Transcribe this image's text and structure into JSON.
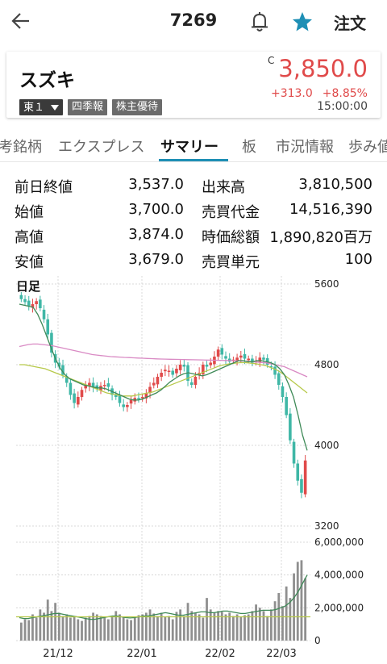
{
  "header": {
    "stock_code": "7269",
    "order_label": "注文"
  },
  "colors": {
    "up": "#e04a4a",
    "down": "#3fb7a6",
    "accent": "#1e8fb5",
    "star": "#1e8fb5"
  },
  "icons": {
    "back": "arrow-left-icon",
    "bell": "bell-icon",
    "star": "star-icon"
  },
  "quote": {
    "name": "スズキ",
    "market": "東１",
    "tag_quarterly": "四季報",
    "tag_benefit": "株主優待",
    "c_mark": "C",
    "price": "3,850.0",
    "change": "+313.0",
    "change_pct": "+8.85%",
    "time": "15:00:00"
  },
  "tabs": [
    {
      "label": "考銘柄"
    },
    {
      "label": "エクスプレス"
    },
    {
      "label": "サマリー",
      "active": true
    },
    {
      "label": "板"
    },
    {
      "label": "市況情報"
    },
    {
      "label": "歩み値"
    }
  ],
  "summary": [
    {
      "label": "前日終値",
      "value": "3,537.0"
    },
    {
      "label": "出来高",
      "value": "3,810,500"
    },
    {
      "label": "始値",
      "value": "3,700.0"
    },
    {
      "label": "売買代金",
      "value": "14,516,390"
    },
    {
      "label": "高値",
      "value": "3,874.0"
    },
    {
      "label": "時価総額",
      "value": "1,890,820百万"
    },
    {
      "label": "安値",
      "value": "3,679.0"
    },
    {
      "label": "売買単元",
      "value": "100"
    }
  ],
  "chart_data": {
    "type": "candlestick",
    "title": "日足",
    "price_axis": {
      "ticks": [
        "5600",
        "4800",
        "4000",
        "3200"
      ],
      "range": [
        3200,
        5600
      ]
    },
    "volume_axis": {
      "ticks": [
        "6,000,000",
        "4,000,000",
        "2,000,000",
        "0"
      ],
      "range": [
        0,
        6000000
      ]
    },
    "x_labels": [
      "21/12",
      "22/01",
      "22/02",
      "22/03"
    ],
    "closes": [
      5450,
      5420,
      5380,
      5400,
      5430,
      5360,
      5250,
      5100,
      4920,
      4820,
      4780,
      4700,
      4620,
      4500,
      4420,
      4480,
      4550,
      4600,
      4620,
      4580,
      4560,
      4590,
      4600,
      4580,
      4500,
      4480,
      4420,
      4380,
      4400,
      4450,
      4470,
      4460,
      4480,
      4520,
      4580,
      4620,
      4680,
      4720,
      4750,
      4740,
      4700,
      4760,
      4800,
      4780,
      4640,
      4600,
      4680,
      4720,
      4800,
      4780,
      4820,
      4880,
      4950,
      4900,
      4860,
      4830,
      4850,
      4870,
      4890,
      4860,
      4860,
      4820,
      4840,
      4870,
      4850,
      4800,
      4780,
      4700,
      4600,
      4480,
      4300,
      4050,
      3820,
      3650,
      3530,
      3850
    ],
    "ma_short": [
      5400,
      5390,
      5380,
      5370,
      5300,
      5200,
      5080,
      4960,
      4850,
      4760,
      4700,
      4660,
      4640,
      4620,
      4600,
      4590,
      4580,
      4570,
      4570,
      4560,
      4540,
      4520,
      4500,
      4480,
      4460,
      4450,
      4450,
      4460,
      4480,
      4500,
      4520,
      4550,
      4590,
      4630,
      4660,
      4690,
      4710,
      4720,
      4710,
      4700,
      4690,
      4700,
      4720,
      4740,
      4760,
      4780,
      4800,
      4820,
      4840,
      4840,
      4830,
      4830,
      4840,
      4840,
      4830,
      4820,
      4800,
      4760,
      4700,
      4600,
      4480,
      4300,
      4100,
      3950
    ],
    "ma_mid": [
      4800,
      4800,
      4790,
      4780,
      4770,
      4760,
      4740,
      4720,
      4700,
      4680,
      4660,
      4640,
      4620,
      4600,
      4580,
      4560,
      4540,
      4520,
      4510,
      4500,
      4490,
      4490,
      4490,
      4500,
      4510,
      4520,
      4530,
      4550,
      4570,
      4590,
      4610,
      4630,
      4650,
      4670,
      4690,
      4710,
      4730,
      4750,
      4770,
      4790,
      4800,
      4810,
      4815,
      4820,
      4820,
      4815,
      4810,
      4800,
      4790,
      4770,
      4750,
      4720,
      4680,
      4640,
      4600,
      4560,
      4520
    ],
    "ma_long": [
      4980,
      4990,
      5000,
      5005,
      5005,
      5000,
      4995,
      4990,
      4980,
      4970,
      4960,
      4950,
      4940,
      4930,
      4920,
      4910,
      4900,
      4895,
      4890,
      4885,
      4880,
      4878,
      4875,
      4872,
      4870,
      4868,
      4866,
      4864,
      4862,
      4860,
      4858,
      4856,
      4855,
      4854,
      4853,
      4852,
      4851,
      4850,
      4849,
      4848,
      4847,
      4846,
      4845,
      4844,
      4843,
      4842,
      4841,
      4840,
      4838,
      4836,
      4834,
      4830,
      4826,
      4822,
      4818,
      4810,
      4800,
      4790,
      4780,
      4760,
      4740,
      4720,
      4700,
      4680
    ],
    "volume": [
      1100000,
      1300000,
      1250000,
      1600000,
      1400000,
      1900000,
      1700000,
      2500000,
      1800000,
      2300000,
      1700000,
      1500000,
      1600000,
      1400000,
      1500000,
      1300000,
      1200000,
      1400000,
      1500000,
      1700000,
      1600000,
      1500000,
      1400000,
      1300000,
      1500000,
      1800000,
      1600000,
      1450000,
      1300000,
      1250000,
      1400000,
      1550000,
      1600000,
      1700000,
      1900000,
      1650000,
      1500000,
      1700000,
      1450000,
      1500000,
      1300000,
      1750000,
      1900000,
      1500000,
      2300000,
      1800000,
      1700000,
      1600000,
      1400000,
      2600000,
      1900000,
      1700000,
      1800000,
      1750000,
      1600000,
      1700000,
      1500000,
      1600000,
      1450000,
      1550000,
      1600000,
      1800000,
      2200000,
      2000000,
      1800000,
      1500000,
      1900000,
      2400000,
      2900000,
      2100000,
      3300000,
      2600000,
      4100000,
      4800000,
      4900000,
      3800000
    ],
    "volume_ma_short": [
      1400000,
      1350000,
      1350000,
      1400000,
      1450000,
      1500000,
      1550000,
      1600000,
      1650000,
      1650000,
      1600000,
      1550000,
      1500000,
      1450000,
      1400000,
      1350000,
      1300000,
      1300000,
      1350000,
      1400000,
      1450000,
      1500000,
      1500000,
      1450000,
      1400000,
      1380000,
      1400000,
      1450000,
      1500000,
      1500000,
      1550000,
      1600000,
      1650000,
      1700000,
      1650000,
      1600000,
      1550000,
      1550000,
      1600000,
      1650000,
      1700000,
      1750000,
      1750000,
      1700000,
      1700000,
      1750000,
      1800000,
      1800000,
      1750000,
      1700000,
      1650000,
      1650000,
      1700000,
      1750000,
      1800000,
      1850000,
      1850000,
      1850000,
      1900000,
      2000000,
      2100000,
      2300000,
      2600000,
      3000000,
      3500000,
      4000000
    ]
  }
}
